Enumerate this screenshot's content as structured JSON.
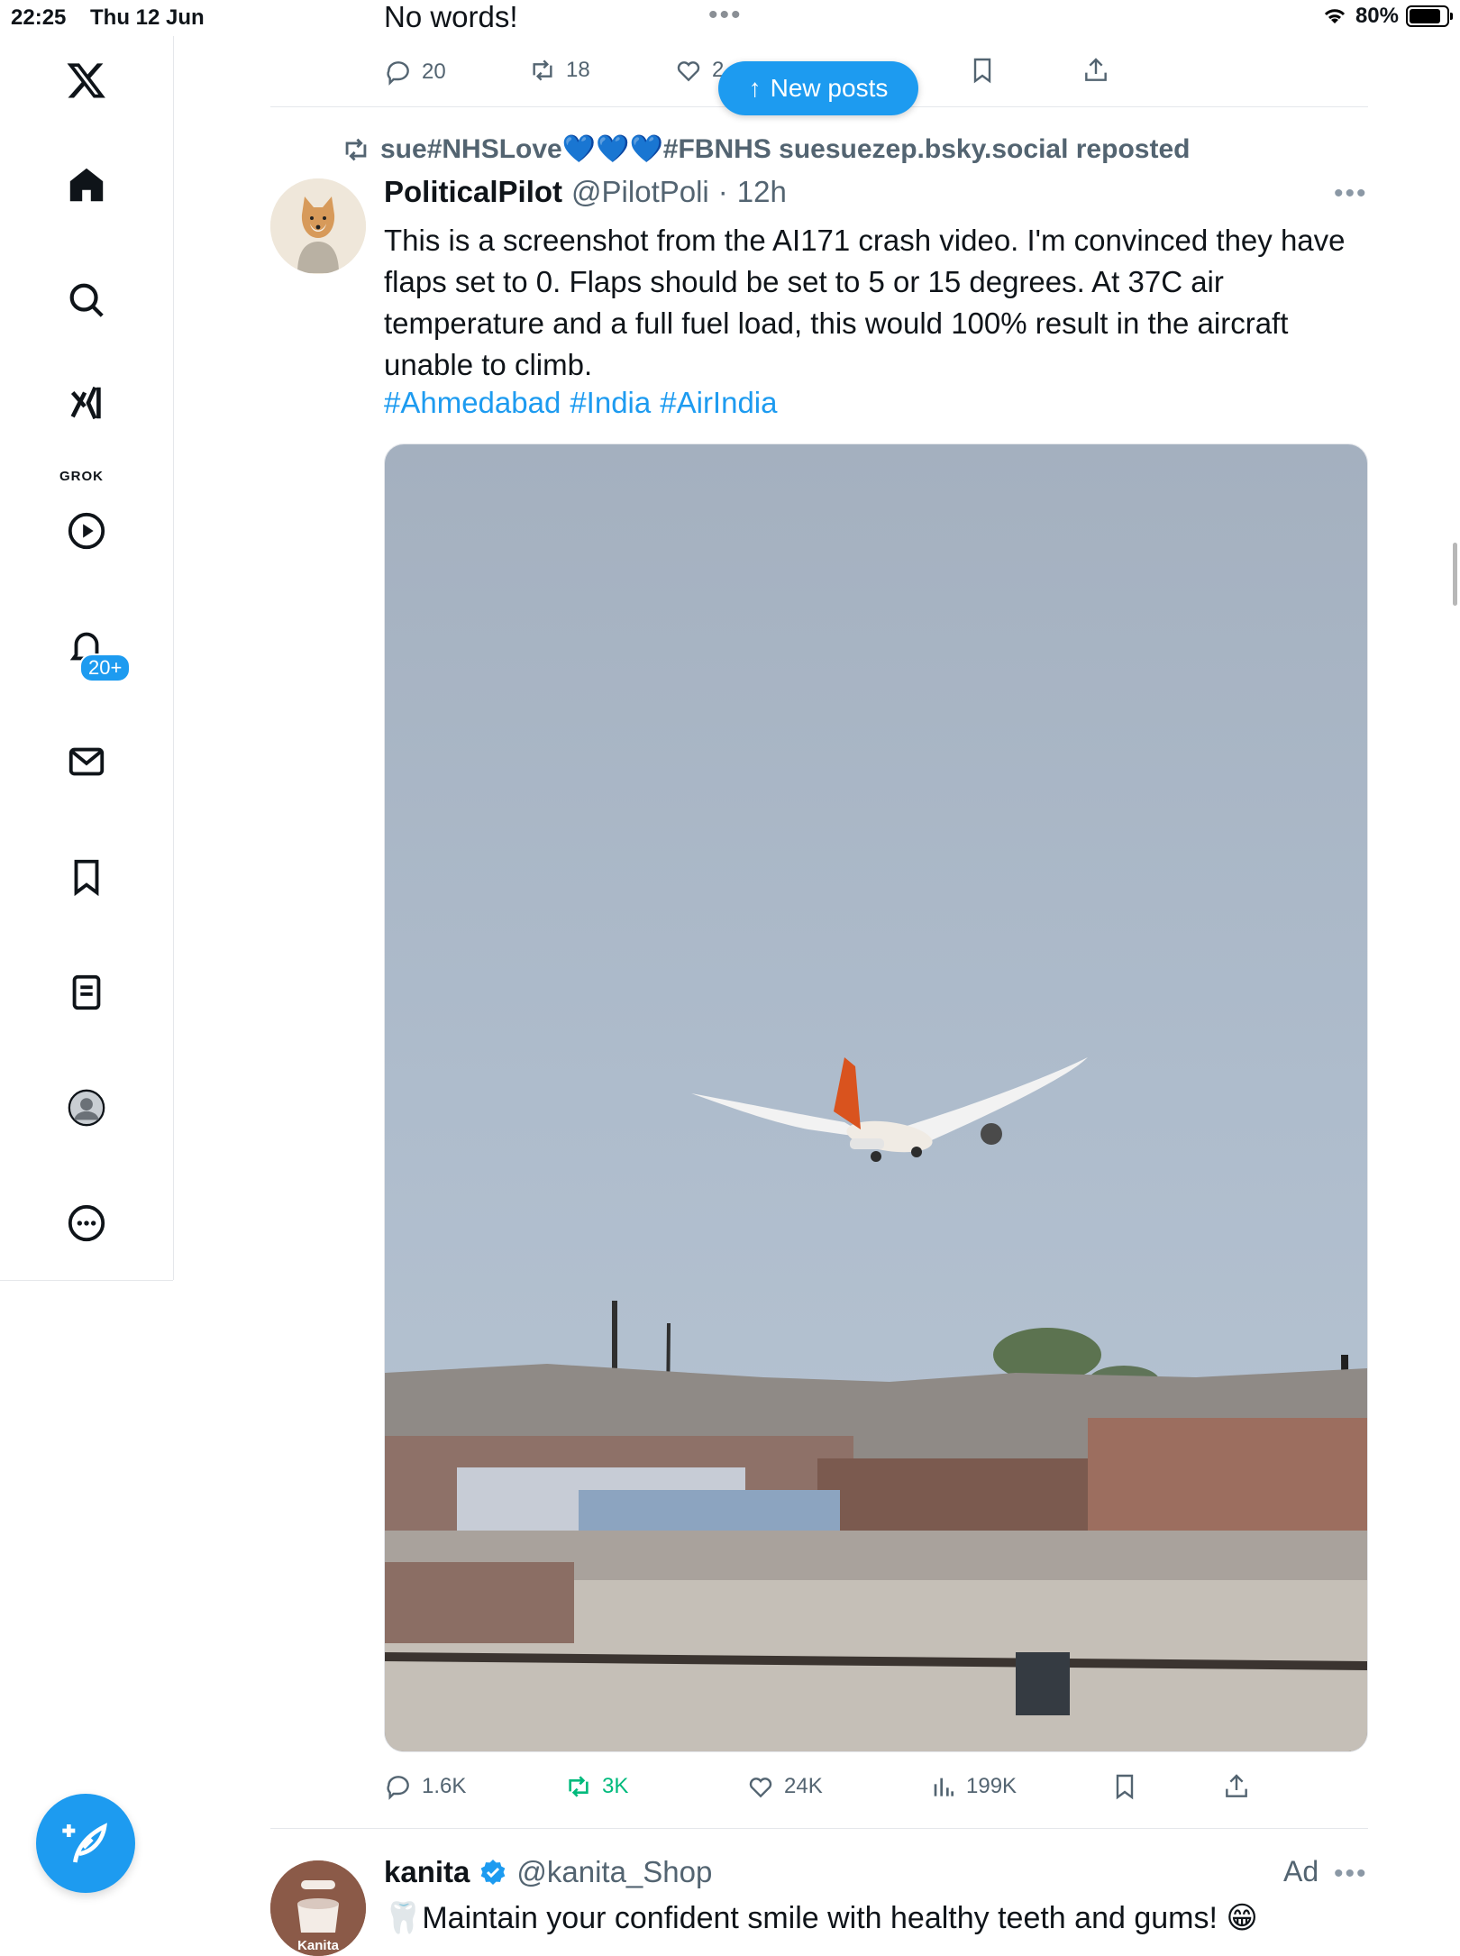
{
  "status_bar": {
    "time": "22:25",
    "date": "Thu 12 Jun",
    "battery": "80%"
  },
  "sidebar": {
    "grok_label": "GROK",
    "notifications_badge": "20+"
  },
  "previous_post": {
    "text": "No words!",
    "replies": "20",
    "reposts": "18",
    "likes": "2"
  },
  "new_posts_button": "New posts",
  "tweet": {
    "repost_by": "sue#NHSLove💙💙💙#FBNHS suesuezep.bsky.social reposted",
    "author_name": "PoliticalPilot",
    "handle": "@PilotPoli",
    "separator": "·",
    "time": "12h",
    "text": "This is a screenshot from the AI171 crash video. I'm convinced they have flaps set to 0. Flaps should be set to 5 or 15 degrees. At 37C air temperature and a full fuel load, this would 100% result in the aircraft unable to climb.",
    "hashtags": [
      "#Ahmedabad",
      "#India",
      "#AirIndia"
    ],
    "replies": "1.6K",
    "reposts": "3K",
    "likes": "24K",
    "views": "199K"
  },
  "ad_post": {
    "avatar_label": "Kanita",
    "author_name": "kanita",
    "handle": "@kanita_Shop",
    "ad_label": "Ad",
    "text": "🦷Maintain your confident smile with healthy teeth and gums! 😁"
  },
  "colors": {
    "accent": "#1d9bf0",
    "repost_green": "#00ba7c",
    "muted": "#536471"
  }
}
